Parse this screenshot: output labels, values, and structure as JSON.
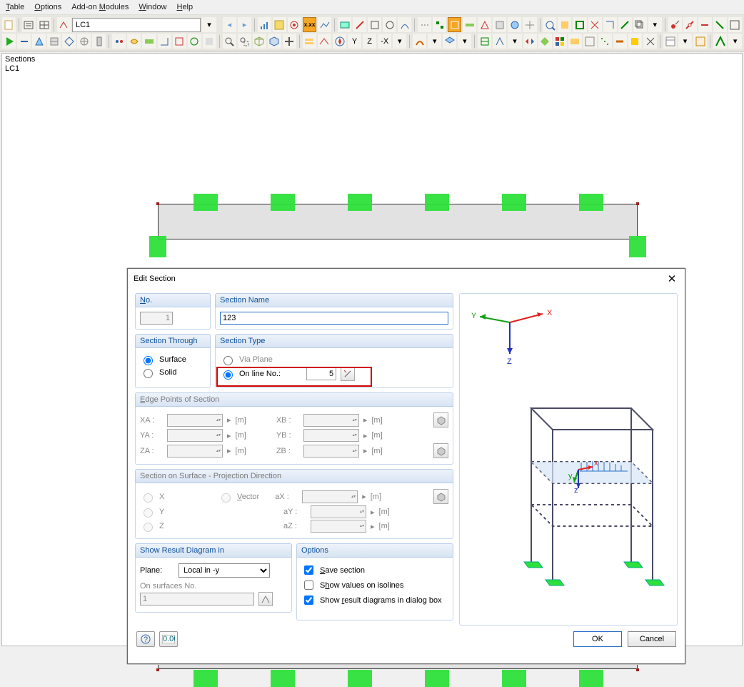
{
  "menu": {
    "items": [
      "Table",
      "Options",
      "Add-on Modules",
      "Window",
      "Help"
    ]
  },
  "toolbar": {
    "lc_value": "LC1"
  },
  "canvas": {
    "title": "Sections",
    "subtitle": "LC1"
  },
  "dialog": {
    "title": "Edit Section",
    "no_group": "No.",
    "no_value": "1",
    "section_name_group": "Section Name",
    "section_name_value": "123",
    "section_through_group": "Section Through",
    "through_surface": "Surface",
    "through_solid": "Solid",
    "section_type_group": "Section Type",
    "type_via_plane": "Via Plane",
    "type_on_line": "On line No.:",
    "on_line_value": "5",
    "edge_group": "Edge Points of Section",
    "labels": {
      "xa": "XA :",
      "ya": "YA :",
      "za": "ZA :",
      "xb": "XB :",
      "yb": "YB :",
      "zb": "ZB :"
    },
    "unit_m": "[m]",
    "proj_group": "Section on Surface - Projection Direction",
    "proj_x": "X",
    "proj_y": "Y",
    "proj_z": "Z",
    "proj_vector": "Vector",
    "proj_ax": "aX :",
    "proj_ay": "aY :",
    "proj_az": "aZ :",
    "show_group": "Show Result Diagram in",
    "plane_label": "Plane:",
    "plane_value": "Local in -y",
    "on_surfaces_label": "On surfaces No.",
    "on_surfaces_value": "1",
    "options_group": "Options",
    "opt_save": "Save section",
    "opt_iso": "Show values on isolines",
    "opt_result": "Show result diagrams in dialog box",
    "ok": "OK",
    "cancel": "Cancel",
    "axis_x": "X",
    "axis_y": "Y",
    "axis_z": "Z"
  }
}
